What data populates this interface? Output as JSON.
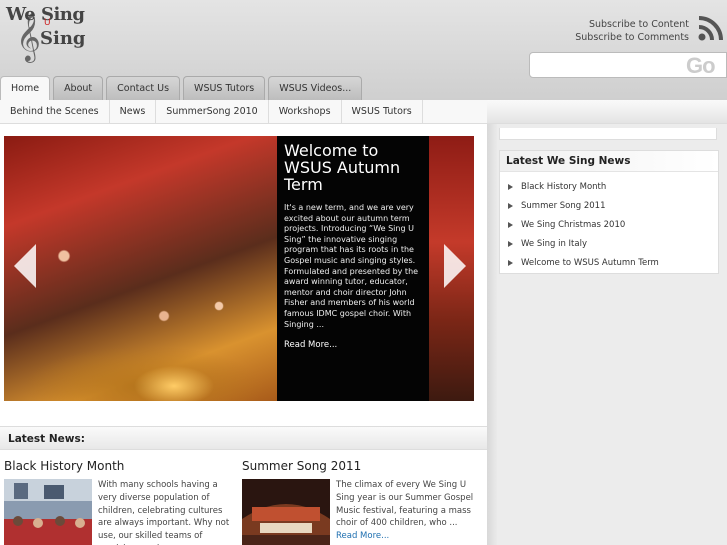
{
  "header": {
    "logo_text_top": "We Sing",
    "logo_text_u": "U",
    "logo_text_bottom": "Sing",
    "subscribe_content": "Subscribe to Content",
    "subscribe_comments": "Subscribe to Comments",
    "search_button": "Go",
    "search_placeholder": ""
  },
  "tabs": [
    "Home",
    "About",
    "Contact Us",
    "WSUS Tutors",
    "WSUS Videos..."
  ],
  "subnav": [
    "Behind the Scenes",
    "News",
    "SummerSong 2010",
    "Workshops",
    "WSUS Tutors"
  ],
  "slider": {
    "title": "Welcome to WSUS Autumn Term",
    "text": "It's a new term, and we are very excited about our autumn term projects. Introducing “We Sing U Sing” the innovative singing program that has its roots in the Gospel music and singing styles. Formulated and presented by the award winning tutor, educator, mentor and choir director John Fisher and members of his world famous IDMC gospel choir. With Singing ...",
    "read_more": "Read More..."
  },
  "latest_news": {
    "heading": "Latest News:",
    "items": [
      {
        "title": "Black History Month",
        "excerpt": "With many schools having a very diverse population of children, celebrating cultures are always important. Why not use, our skilled teams of musicians and"
      },
      {
        "title": "Summer Song 2011",
        "excerpt": "The climax of every We Sing U Sing year is our Summer Gospel Music festival, featuring a mass choir of 400 children, who ...",
        "read_more": "Read More..."
      }
    ]
  },
  "sidebar": {
    "heading": "Latest We Sing News",
    "items": [
      "Black History Month",
      "Summer Song 2011",
      "We Sing Christmas 2010",
      "We Sing in Italy",
      "Welcome to WSUS Autumn Term"
    ]
  },
  "colors": {
    "link": "#1e6fb0",
    "caption_bg": "#000000",
    "tab_active": "#f8f8f8"
  }
}
